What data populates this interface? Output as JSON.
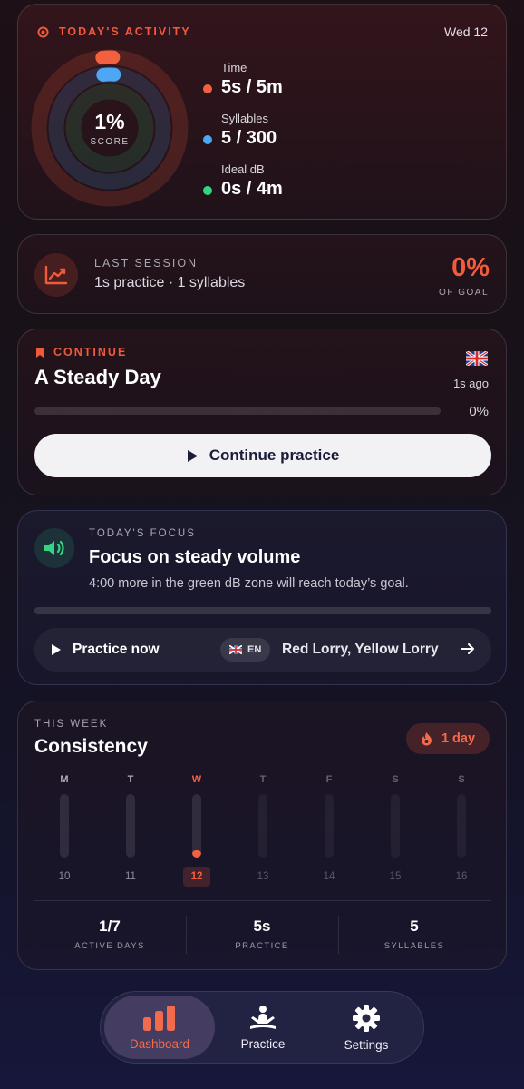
{
  "activity": {
    "title": "TODAY'S ACTIVITY",
    "date": "Wed 12",
    "score_value": "1%",
    "score_label": "SCORE",
    "metrics": [
      {
        "label": "Time",
        "value": "5s / 5m",
        "color": "#f2613f",
        "progress": 0.017
      },
      {
        "label": "Syllables",
        "value": "5 / 300",
        "color": "#4ea7f5",
        "progress": 0.017
      },
      {
        "label": "Ideal dB",
        "value": "0s / 4m",
        "color": "#35d483",
        "progress": 0
      }
    ]
  },
  "last_session": {
    "label": "LAST SESSION",
    "summary": "1s practice · 1 syllables",
    "percent": "0%",
    "percent_label": "OF GOAL"
  },
  "continue": {
    "label": "CONTINUE",
    "title": "A Steady Day",
    "time_ago": "1s ago",
    "percent": "0%",
    "progress": 0,
    "button_label": "Continue practice"
  },
  "focus": {
    "label": "TODAY'S FOCUS",
    "title": "Focus on steady volume",
    "description": "4:00 more in the green dB zone will reach today’s goal.",
    "progress": 0,
    "practice_label": "Practice now",
    "lang": "EN",
    "tongue_twister": "Red Lorry, Yellow Lorry"
  },
  "week": {
    "label": "THIS WEEK",
    "title": "Consistency",
    "streak": "1 day",
    "days": [
      {
        "letter": "M",
        "num": "10",
        "state": "past",
        "level": 0
      },
      {
        "letter": "T",
        "num": "11",
        "state": "past",
        "level": 0
      },
      {
        "letter": "W",
        "num": "12",
        "state": "today",
        "level": 0.1
      },
      {
        "letter": "T",
        "num": "13",
        "state": "future",
        "level": 0
      },
      {
        "letter": "F",
        "num": "14",
        "state": "future",
        "level": 0
      },
      {
        "letter": "S",
        "num": "15",
        "state": "future",
        "level": 0
      },
      {
        "letter": "S",
        "num": "16",
        "state": "future",
        "level": 0
      }
    ],
    "stats": [
      {
        "value": "1/7",
        "label": "ACTIVE DAYS"
      },
      {
        "value": "5s",
        "label": "PRACTICE"
      },
      {
        "value": "5",
        "label": "SYLLABLES"
      }
    ]
  },
  "nav": {
    "items": [
      {
        "label": "Dashboard",
        "icon": "bar-chart-icon",
        "active": true
      },
      {
        "label": "Practice",
        "icon": "meditation-icon",
        "active": false
      },
      {
        "label": "Settings",
        "icon": "gear-icon",
        "active": false
      }
    ]
  },
  "colors": {
    "accent": "#f2613f",
    "blue": "#4ea7f5",
    "green": "#35d483"
  }
}
